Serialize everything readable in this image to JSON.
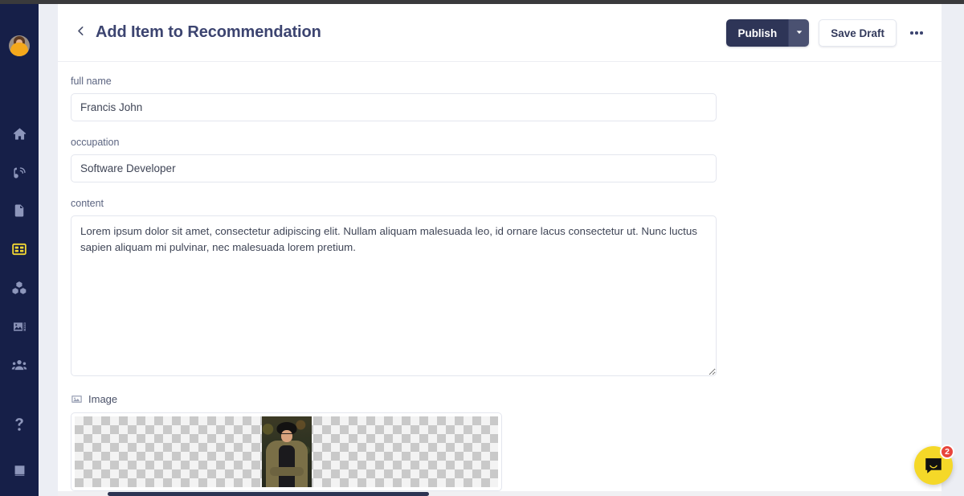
{
  "header": {
    "title": "Add Item to Recommendation",
    "back_icon": "chevron-left-icon",
    "publish_label": "Publish",
    "publish_caret_icon": "chevron-down-icon",
    "save_draft_label": "Save Draft",
    "more_icon": "ellipsis-icon",
    "accent_color": "#2e3557"
  },
  "sidebar": {
    "background_color": "#161f48",
    "active_color": "#f3d733",
    "avatar": {
      "name": "user-avatar"
    },
    "items": [
      {
        "name": "sidebar-item-home",
        "icon": "home-icon",
        "active": false
      },
      {
        "name": "sidebar-item-blog",
        "icon": "blog-icon",
        "active": false
      },
      {
        "name": "sidebar-item-pages",
        "icon": "page-icon",
        "active": false
      },
      {
        "name": "sidebar-item-sections",
        "icon": "layout-icon",
        "active": true
      },
      {
        "name": "sidebar-item-products",
        "icon": "cubes-icon",
        "active": false
      },
      {
        "name": "sidebar-item-media",
        "icon": "images-icon",
        "active": false
      },
      {
        "name": "sidebar-item-people",
        "icon": "people-icon",
        "active": false
      },
      {
        "name": "sidebar-item-help",
        "icon": "question-icon",
        "active": false
      },
      {
        "name": "sidebar-item-docs",
        "icon": "book-icon",
        "active": false
      }
    ]
  },
  "form": {
    "fields": [
      {
        "label": "full name",
        "value": "Francis John",
        "type": "text"
      },
      {
        "label": "occupation",
        "value": "Software Developer",
        "type": "text"
      },
      {
        "label": "content",
        "value": "Lorem ipsum dolor sit amet, consectetur adipiscing elit. Nullam aliquam malesuada leo, id ornare lacus consectetur ut. Nunc luctus sapien aliquam mi pulvinar, nec malesuada lorem pretium.",
        "type": "textarea"
      }
    ],
    "image_section": {
      "label": "Image",
      "icon": "image-icon"
    }
  },
  "chat": {
    "icon": "chat-bubble-icon",
    "badge_count": "2",
    "color": "#f5d828",
    "badge_color": "#e8453c"
  }
}
